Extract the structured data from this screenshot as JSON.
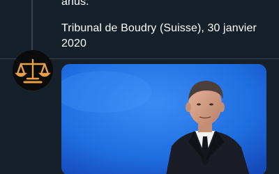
{
  "tweet": {
    "text_line_1": "anus.",
    "source_line_1": "Tribunal de Boudry (Suisse), 30 janvier",
    "source_line_2": "2020"
  },
  "reply": {
    "avatar_icon": "scales-of-justice-icon",
    "media": {
      "icon": "photo-man-in-suit-blue-background"
    }
  },
  "colors": {
    "tweet_background": "#15202b",
    "page_background": "#000000",
    "text": "#ffffff",
    "divider": "#38444d",
    "avatar_icon": "#e8a04a",
    "media_background": "#1e6fe0"
  }
}
